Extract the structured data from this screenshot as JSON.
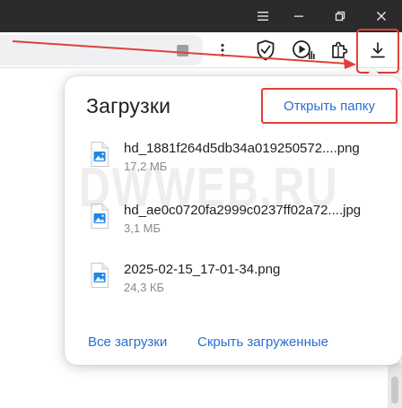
{
  "window_controls": {
    "menu_icon": "hamburger-menu-icon",
    "minimize_icon": "minimize-icon",
    "restore_icon": "restore-icon",
    "close_icon": "close-icon"
  },
  "toolbar": {
    "icons": [
      "more-vertical-icon",
      "shield-check-icon",
      "media-play-icon",
      "extensions-icon",
      "download-icon"
    ]
  },
  "downloads_panel": {
    "title": "Загрузки",
    "open_folder": "Открыть папку",
    "files": [
      {
        "name": "hd_1881f264d5db34a019250572....png",
        "size": "17,2 МБ"
      },
      {
        "name": "hd_ae0c0720fa2999c0237ff02a72....jpg",
        "size": "3,1 МБ"
      },
      {
        "name": "2025-02-15_17-01-34.png",
        "size": "24,3 КБ"
      }
    ],
    "all_downloads": "Все загрузки",
    "hide_downloaded": "Скрыть загруженные"
  },
  "watermark": "DWWEB.RU",
  "colors": {
    "titlebar": "#2b2b2b",
    "accent_link": "#2a6fcf",
    "annotation_red": "#e0403a",
    "file_icon_blue": "#1e88e5"
  }
}
